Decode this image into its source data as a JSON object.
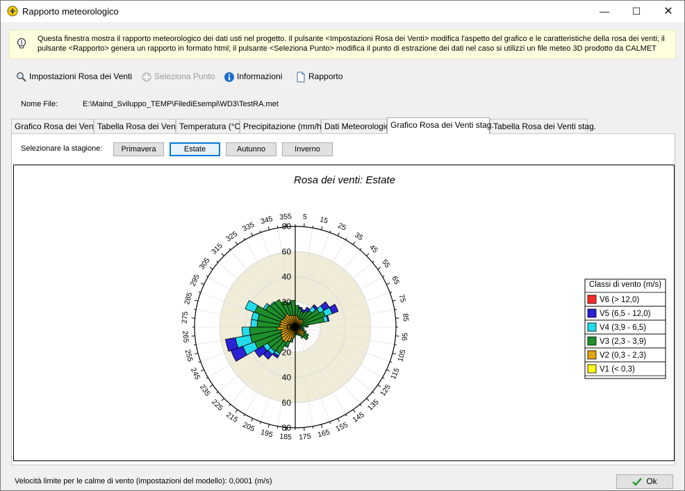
{
  "window": {
    "title": "Rapporto meteorologico"
  },
  "info": "Questa finestra mostra il rapporto meteorologico dei dati usti nel progetto. Il pulsante <Impostazioni Rosa dei Venti> modifica l'aspetto del grafico e le caratteristiche della rosa dei venti; il pulsante <Rapporto> genera un rapporto in formato html; il pulsante <Seleziona Punto> modifica il punto di estrazione dei dati nel caso si utilizzi un file meteo 3D prodotto da CALMET",
  "toolbar": {
    "settings": "Impostazioni Rosa dei Venti",
    "select_point": "Seleziona Punto",
    "info": "Informazioni",
    "report": "Rapporto"
  },
  "file": {
    "label": "Nome File:",
    "path": "E:\\Maind_Sviluppo_TEMP\\FilediEsempi\\WD3\\TestRA.met"
  },
  "tabs": [
    "Grafico Rosa dei Venti",
    "Tabella Rosa dei Venti",
    "Temperatura (°C)",
    "Precipitazione (mm/hr)",
    "Dati Meteorologici",
    "Grafico Rosa dei Venti stag.",
    "Tabella Rosa dei Venti stag."
  ],
  "season": {
    "label": "Selezionare la stagione:",
    "buttons": [
      "Primavera",
      "Estate",
      "Autunno",
      "Inverno"
    ],
    "selected": "Estate"
  },
  "status": {
    "text": "Velocità limite per le calme di vento (impostazioni del modello): 0,0001 (m/s)",
    "ok": "Ok"
  },
  "chart_data": {
    "type": "polar-bar",
    "title": "Rosa dei venti: Estate",
    "stacked": true,
    "direction_labels": [
      "5",
      "15",
      "25",
      "35",
      "45",
      "55",
      "65",
      "75",
      "85",
      "95",
      "105",
      "115",
      "125",
      "135",
      "145",
      "155",
      "165",
      "175",
      "185",
      "195",
      "205",
      "215",
      "225",
      "235",
      "245",
      "255",
      "265",
      "275",
      "285",
      "295",
      "305",
      "315",
      "325",
      "335",
      "345",
      "355"
    ],
    "radial_ticks": [
      "0",
      "20",
      "40",
      "60",
      "80"
    ],
    "rmax": 80,
    "legend": {
      "title": "Classi di vento (m/s)",
      "position": "right",
      "items": [
        {
          "label": "V6 (> 12,0)",
          "color": "#ff2a2a"
        },
        {
          "label": "V5 (6,5 - 12,0)",
          "color": "#2a22d4"
        },
        {
          "label": "V4 (3,9 - 6,5)",
          "color": "#22dcea"
        },
        {
          "label": "V3 (2,3 - 3,9)",
          "color": "#1e8f2a"
        },
        {
          "label": "V2 (0,3 - 2,3)",
          "color": "#e0a20e"
        },
        {
          "label": "V1 (< 0,3)",
          "color": "#ffff20"
        }
      ]
    },
    "band_color": "#f0ecd8",
    "directions": [
      5,
      15,
      25,
      35,
      45,
      55,
      65,
      75,
      85,
      95,
      105,
      115,
      125,
      135,
      145,
      155,
      165,
      175,
      185,
      195,
      205,
      215,
      225,
      235,
      245,
      255,
      265,
      275,
      285,
      295,
      305,
      315,
      325,
      335,
      345,
      355
    ],
    "series": [
      {
        "name": "V1 (< 0,3)",
        "values": [
          0.3,
          0.3,
          0.3,
          0.3,
          0.3,
          0.3,
          0.3,
          0.3,
          0.3,
          0.3,
          0.3,
          0.3,
          0.3,
          0.3,
          0.3,
          0.3,
          0.3,
          0.3,
          0.3,
          0.3,
          0.3,
          0.3,
          0.3,
          0.3,
          0.3,
          0.3,
          0.3,
          0.3,
          0.3,
          0.3,
          0.3,
          0.3,
          0.3,
          0.3,
          0.3,
          0.3
        ]
      },
      {
        "name": "V2 (0,3 - 2,3)",
        "values": [
          9,
          8,
          7,
          7,
          8,
          7,
          5,
          4,
          3,
          3,
          4,
          6,
          8,
          9,
          7,
          5,
          4,
          4,
          5,
          9,
          12,
          14,
          14,
          13,
          12,
          11,
          14,
          12,
          12,
          12,
          11,
          11,
          12,
          10,
          9,
          9
        ]
      },
      {
        "name": "V3 (2,3 - 3,9)",
        "values": [
          8,
          7,
          6,
          7,
          9,
          15,
          20,
          19,
          6,
          3,
          3,
          3,
          4,
          4,
          3,
          2,
          2,
          2,
          3,
          3,
          4,
          10,
          11,
          12,
          22,
          25,
          22,
          18,
          18,
          22,
          16,
          14,
          13,
          12,
          10,
          12
        ]
      },
      {
        "name": "V4 (3,9 - 6,5)",
        "values": [
          0,
          0,
          0,
          1,
          4,
          4,
          6,
          3,
          1,
          0,
          0,
          0,
          0,
          0,
          0,
          0,
          0,
          0,
          0,
          0,
          1,
          2,
          3,
          4,
          10,
          12,
          6,
          5,
          5,
          8,
          2,
          1,
          0,
          0,
          1,
          0
        ]
      },
      {
        "name": "V5 (6,5 - 12,0)",
        "values": [
          0,
          1,
          2,
          3,
          2,
          5,
          5,
          1,
          0,
          0,
          0,
          0,
          0,
          0,
          0,
          0,
          0,
          0,
          0,
          0,
          0,
          2,
          5,
          8,
          10,
          8,
          0,
          0,
          0,
          0,
          0,
          0,
          0,
          0,
          0,
          0
        ]
      },
      {
        "name": "V6 (> 12,0)",
        "values": [
          0,
          0,
          0,
          0,
          0,
          0,
          0,
          0,
          0,
          0,
          0,
          0,
          0,
          0,
          0,
          0,
          0,
          0,
          0,
          0,
          0,
          0,
          0,
          0,
          0,
          0,
          0,
          0,
          0,
          0,
          0,
          0,
          0,
          0,
          0,
          0
        ]
      }
    ]
  }
}
